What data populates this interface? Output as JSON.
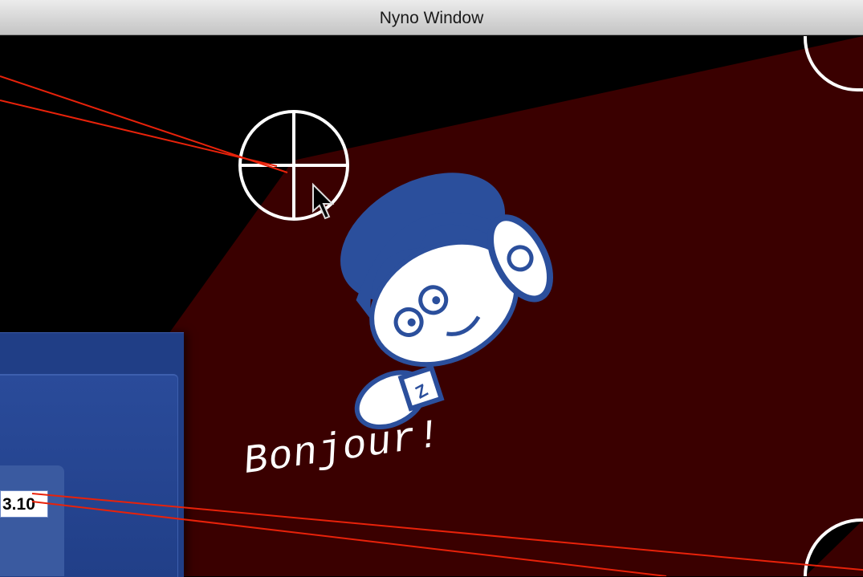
{
  "window": {
    "title": "Nyno Window"
  },
  "canvas": {
    "greeting": "Bonjour!",
    "background_color": "#000000",
    "projection_color": "#3a0000",
    "mascot_color": "#2b4f9c"
  },
  "panel": {
    "value": "3.10",
    "background_color": "#203e86"
  },
  "annotations": {
    "callout_line_color": "#e8220a"
  }
}
